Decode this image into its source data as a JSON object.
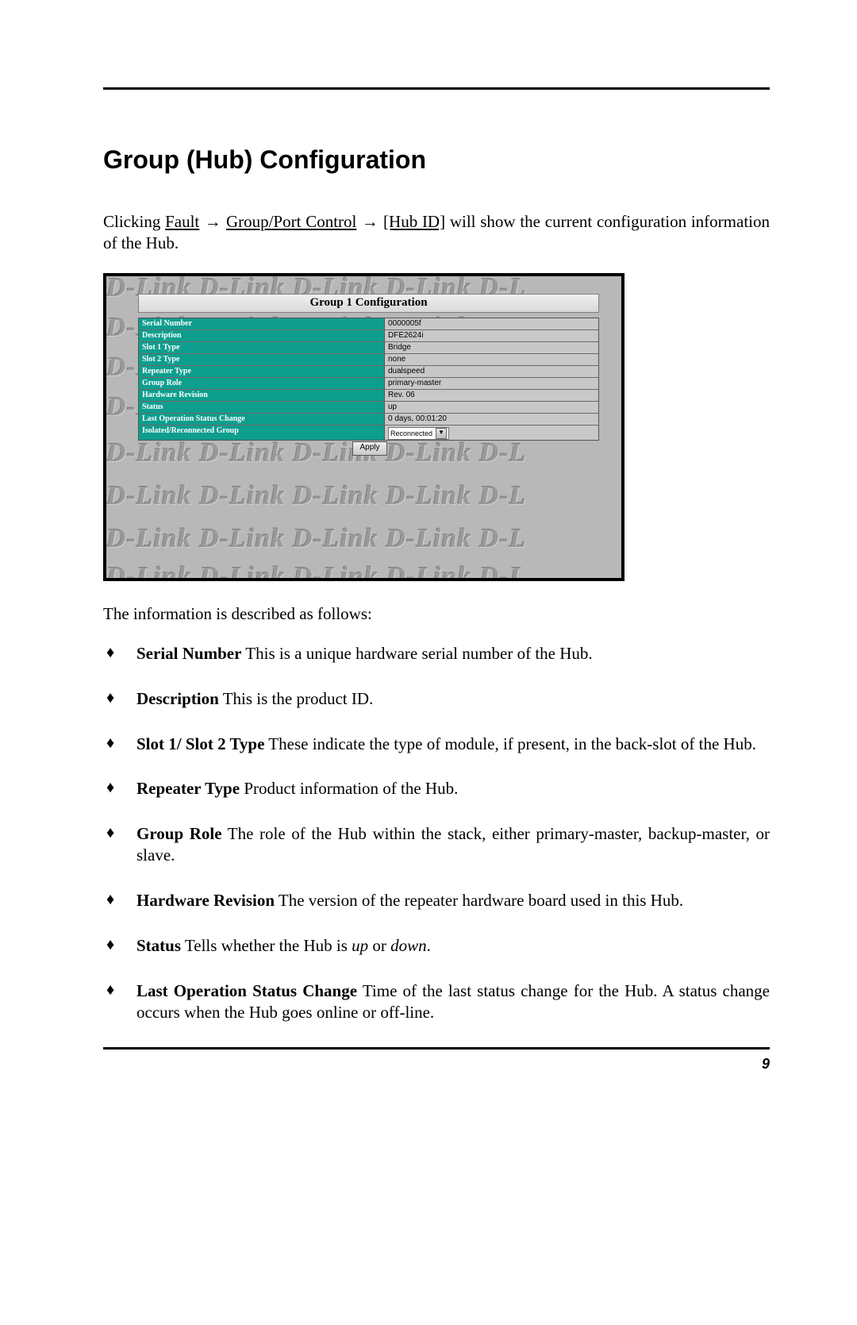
{
  "heading": "Group (Hub) Configuration",
  "intro": {
    "prefix": "Clicking ",
    "link1": "Fault",
    "arrow": " → ",
    "link2": "Group/Port Control",
    "link3": "[Hub ID]",
    "suffix": " will show the current configuration information of the Hub."
  },
  "screenshot": {
    "watermark": "D-Link   D-Link   D-Link   D-Link   D-L",
    "title": "Group 1 Configuration",
    "rows": [
      {
        "label": "Serial Number",
        "value": "0000005f"
      },
      {
        "label": "Description",
        "value": "DFE2624i"
      },
      {
        "label": "Slot 1 Type",
        "value": "Bridge"
      },
      {
        "label": "Slot 2 Type",
        "value": "none"
      },
      {
        "label": "Repeater Type",
        "value": "dualspeed"
      },
      {
        "label": "Group Role",
        "value": "primary-master"
      },
      {
        "label": "Hardware Revision",
        "value": "Rev. 06"
      },
      {
        "label": "Status",
        "value": "up"
      },
      {
        "label": "Last Operation Status Change",
        "value": "0 days, 00:01:20"
      },
      {
        "label": "Isolated/Reconnected Group",
        "value": "Reconnected"
      }
    ],
    "apply": "Apply"
  },
  "lead": "The information is described as follows:",
  "bullets": [
    {
      "term": "Serial Number",
      "gap": "    ",
      "desc": "This is a unique hardware serial number of the Hub."
    },
    {
      "term": "Description",
      "gap": "    ",
      "desc": "This is the product ID."
    },
    {
      "term": "Slot 1/ Slot 2 Type",
      "gap": "    ",
      "desc": "These indicate the type of module, if present, in the back-slot of the Hub."
    },
    {
      "term": "Repeater Type",
      "gap": "    ",
      "desc": "Product information of the Hub."
    },
    {
      "term": "Group Role",
      "gap": "    ",
      "desc": "The role of the Hub within the stack, either primary-master, backup-master, or slave."
    },
    {
      "term": "Hardware Revision",
      "gap": "    ",
      "desc": "The version of the repeater hardware board used in this Hub."
    },
    {
      "term": "Status",
      "gap": "    ",
      "desc_pre": "Tells whether the Hub is ",
      "it1": "up",
      "mid": " or ",
      "it2": "down",
      "desc_post": "."
    },
    {
      "term": "Last Operation Status Change",
      "gap": "    ",
      "desc": "Time of the last status change for the Hub.  A status change occurs when the Hub goes online or off-line."
    }
  ],
  "pagenum": "9"
}
